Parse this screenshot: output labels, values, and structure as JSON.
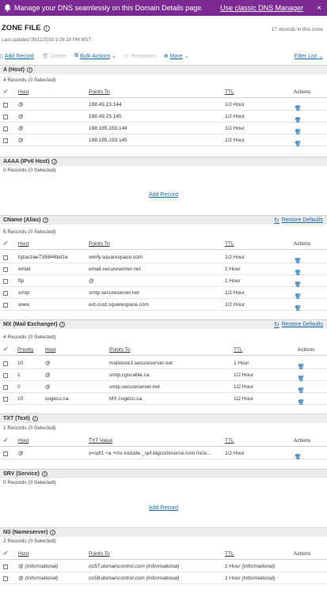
{
  "banner": {
    "message": "Manage your DNS seamlessly on this Domain Details page.",
    "link": "Use classic DNS Manager",
    "close": "×"
  },
  "zone": {
    "title": "ZONE FILE",
    "records_count": "17 records in this zone",
    "last_updated": "Last updated 09/12/2015 3:26:16 PM MST"
  },
  "toolbar": {
    "add": "Add Record",
    "delete": "Delete",
    "bulk": "Bulk Actions",
    "templates": "Templates",
    "more": "More",
    "filter": "Filter List"
  },
  "columns": {
    "host": "Host",
    "points_to": "Points To",
    "ttl": "TTL",
    "actions": "Actions",
    "priority": "Priority",
    "txt_value": "TXT Value"
  },
  "restore_defaults": "Restore Defaults",
  "add_record": "Add Record",
  "sections": {
    "a": {
      "title": "A (Host)",
      "count": "4 Records (0 Selected)",
      "rows": [
        {
          "host": "@",
          "points": "198.49.23.144",
          "ttl": "1/2 Hour"
        },
        {
          "host": "@",
          "points": "198.49.23.145",
          "ttl": "1/2 Hour"
        },
        {
          "host": "@",
          "points": "198.185.159.144",
          "ttl": "1/2 Hour"
        },
        {
          "host": "@",
          "points": "198.185.159.145",
          "ttl": "1/2 Hour"
        }
      ]
    },
    "aaaa": {
      "title": "AAAA (IPv6 Host)",
      "count": "0 Records (0 Selected)"
    },
    "cname": {
      "title": "CName (Alias)",
      "count": "5 Records (0 Selected)",
      "rows": [
        {
          "host": "bjzaczae739l846lefza",
          "points": "verify.squarespace.com",
          "ttl": "1/2 Hour"
        },
        {
          "host": "email",
          "points": "email.secureserver.net",
          "ttl": "1 Hour"
        },
        {
          "host": "ftp",
          "points": "@",
          "ttl": "1 Hour"
        },
        {
          "host": "smtp",
          "points": "smtp.secureserver.net",
          "ttl": "1/2 Hour"
        },
        {
          "host": "www",
          "points": "ext-cust.squarespace.com",
          "ttl": "1/2 Hour"
        }
      ]
    },
    "mx": {
      "title": "MX (Mail Exchanger)",
      "count": "4 Records (0 Selected)",
      "rows": [
        {
          "priority": "10",
          "host": "@",
          "points": "mailstore1.secureserver.net",
          "ttl": "1 Hour"
        },
        {
          "priority": "1",
          "host": "@",
          "points": "smtp.cgocable.ca",
          "ttl": "1/2 Hour"
        },
        {
          "priority": "0",
          "host": "@",
          "points": "smtp.secureserver.net",
          "ttl": "1/2 Hour"
        },
        {
          "priority": "10",
          "host": "cogeco.ca",
          "points": "MX cogeco.ca",
          "ttl": "1/2 Hour"
        }
      ]
    },
    "txt": {
      "title": "TXT (Text)",
      "count": "1 Records (0 Selected)",
      "rows": [
        {
          "host": "@",
          "value": "v=spf1 +a +mx include:_spf.bigcommerce.com inclu...",
          "ttl": "1/2 Hour"
        }
      ]
    },
    "srv": {
      "title": "SRV (Service)",
      "count": "0 Records (0 Selected)"
    },
    "ns": {
      "title": "NS (Nameserver)",
      "count": "2 Records (0 Selected)",
      "rows": [
        {
          "host": "@ (Informational)",
          "points": "ns57.domaincontrol.com (Informational)",
          "ttl": "1 Hour (Informational)"
        },
        {
          "host": "@ (Informational)",
          "points": "ns58.domaincontrol.com (Informational)",
          "ttl": "1 Hour (Informational)"
        }
      ]
    }
  }
}
